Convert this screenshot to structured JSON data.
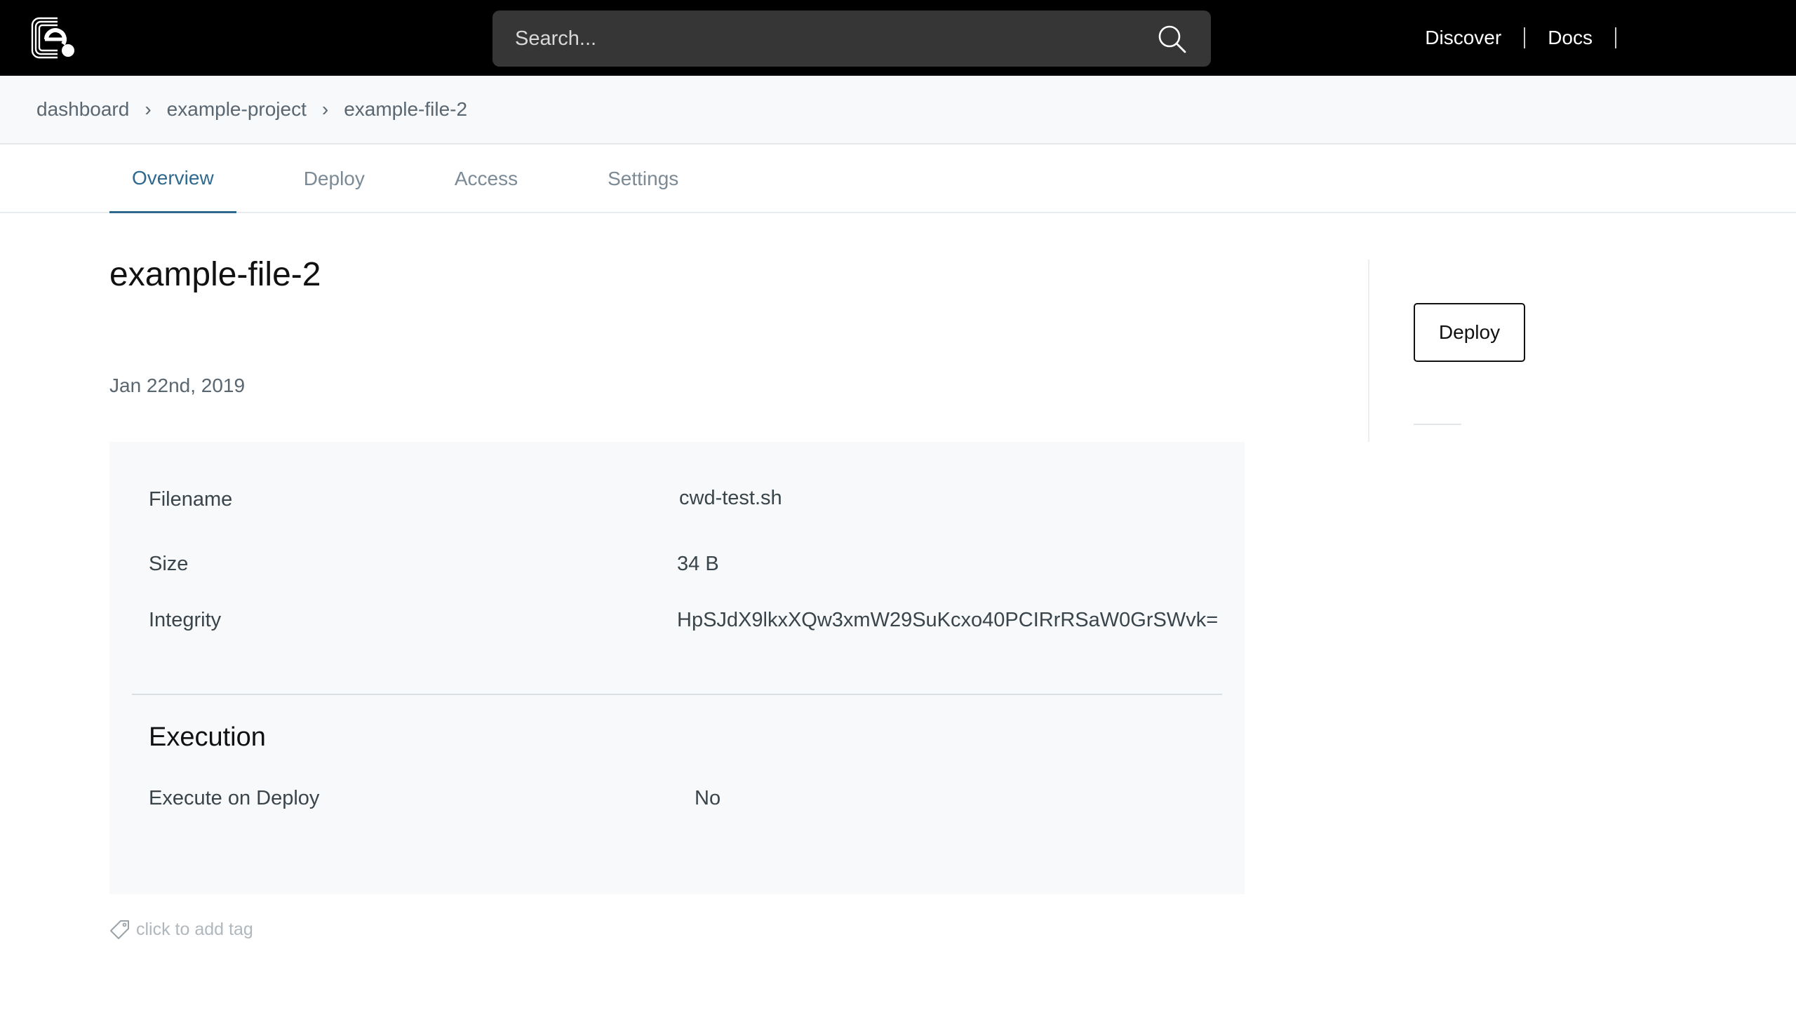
{
  "header": {
    "search_placeholder": "Search...",
    "nav": [
      {
        "label": "Discover"
      },
      {
        "label": "Docs"
      }
    ]
  },
  "breadcrumb": {
    "items": [
      "dashboard",
      "example-project",
      "example-file-2"
    ],
    "separator": "›"
  },
  "tabs": [
    {
      "label": "Overview",
      "active": true
    },
    {
      "label": "Deploy",
      "active": false
    },
    {
      "label": "Access",
      "active": false
    },
    {
      "label": "Settings",
      "active": false
    }
  ],
  "file": {
    "title": "example-file-2",
    "date": "Jan 22nd, 2019",
    "details": {
      "filename_label": "Filename",
      "filename_value": "cwd-test.sh",
      "size_label": "Size",
      "size_value": "34 B",
      "integrity_label": "Integrity",
      "integrity_value": "HpSJdX9lkxXQw3xmW29SuKcxo40PCIRrRSaW0GrSWvk="
    },
    "execution": {
      "title": "Execution",
      "execute_label": "Execute on Deploy",
      "execute_value": "No"
    },
    "tag_hint": "click to add tag"
  },
  "sidebar": {
    "deploy_label": "Deploy"
  },
  "colors": {
    "topbar": "#000000",
    "search_bg": "#363636",
    "accent": "#2f6a8e",
    "panel_bg": "#f7f9fa"
  },
  "icons": {
    "logo": "logo-icon",
    "search": "search-icon",
    "tag": "tag-icon"
  }
}
